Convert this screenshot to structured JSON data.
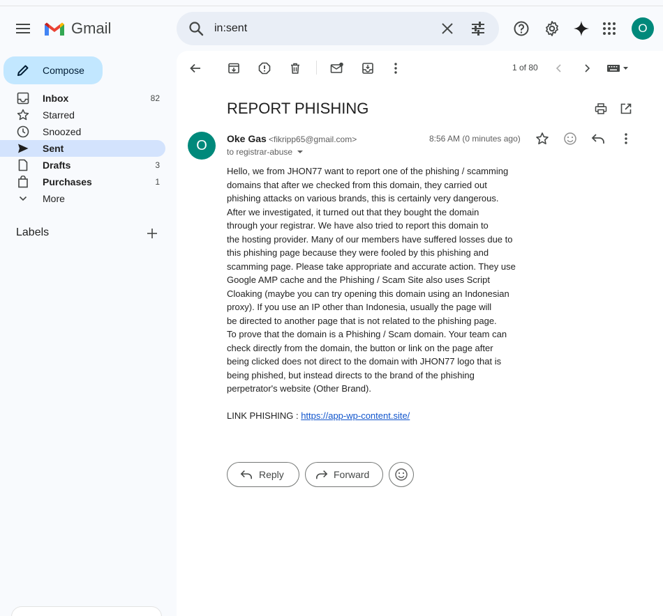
{
  "header": {
    "app_name": "Gmail",
    "search_value": "in:sent",
    "avatar_letter": "O"
  },
  "sidebar": {
    "compose_label": "Compose",
    "items": [
      {
        "label": "Inbox",
        "count": "82"
      },
      {
        "label": "Starred",
        "count": ""
      },
      {
        "label": "Snoozed",
        "count": ""
      },
      {
        "label": "Sent",
        "count": ""
      },
      {
        "label": "Drafts",
        "count": "3"
      },
      {
        "label": "Purchases",
        "count": "1"
      },
      {
        "label": "More",
        "count": ""
      }
    ],
    "labels_heading": "Labels"
  },
  "toolbar": {
    "pager": "1 of 80"
  },
  "email": {
    "subject": "REPORT PHISHING",
    "sender_letter": "O",
    "sender_name": "Oke Gas",
    "sender_email": "<fikripp65@gmail.com>",
    "to": "to registrar-abuse",
    "time": "8:56 AM (0 minutes ago)",
    "body_lines": [
      "Hello, we from JHON77 want to report one of the phishing / scamming",
      "domains that after we checked from this domain, they carried out",
      "phishing attacks on various brands, this is certainly very dangerous.",
      "After we investigated, it turned out that they bought the domain",
      "through your registrar. We have also tried to report this domain to",
      "the hosting provider. Many of our members have suffered losses due to",
      "this phishing page because they were fooled by this phishing and",
      "scamming page. Please take appropriate and accurate action. They use",
      "Google AMP cache and the Phishing / Scam Site also uses Script",
      "Cloaking (maybe you can try opening this domain using an Indonesian",
      "proxy). If you use an IP other than Indonesia, usually the page will",
      "be directed to another page that is not related to the phishing page.",
      "To prove that the domain is a Phishing / Scam domain. Your team can",
      "check directly from the domain, the button or link on the page after",
      "being clicked does not direct to the domain with JHON77 logo that is",
      "being phished, but instead directs to the brand of the phishing",
      "perpetrator's website (Other Brand)."
    ],
    "link_prefix": "LINK PHISHING : ",
    "link_text": "https://app-wp-content.site/"
  },
  "actions": {
    "reply_label": "Reply",
    "forward_label": "Forward"
  },
  "colors": {
    "accent_blue": "#c2e7ff",
    "active_nav": "#d3e3fd",
    "avatar_teal": "#00897b",
    "link": "#1155cc"
  }
}
